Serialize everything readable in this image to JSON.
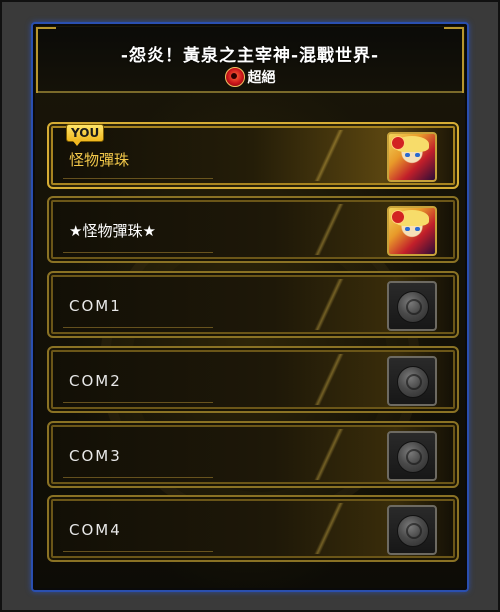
{
  "header": {
    "title": "-怨炎！黃泉之主宰神-混戰世界-",
    "difficulty": {
      "label": "超絕",
      "icon": "difficulty-emblem-icon"
    }
  },
  "players": [
    {
      "badge": "YOU",
      "name": "怪物彈珠",
      "avatar": "character-portrait-icon",
      "is_self": true
    },
    {
      "name": "★怪物彈珠★",
      "avatar": "character-portrait-icon",
      "is_self": false
    },
    {
      "name": "COM1",
      "avatar": "empty-orb-icon",
      "is_self": false
    },
    {
      "name": "COM2",
      "avatar": "empty-orb-icon",
      "is_self": false
    },
    {
      "name": "COM3",
      "avatar": "empty-orb-icon",
      "is_self": false
    },
    {
      "name": "COM4",
      "avatar": "empty-orb-icon",
      "is_self": false
    }
  ],
  "colors": {
    "panel_border": "#2a4fb0",
    "gold": "#d6ad35",
    "you_text": "#f2c84a"
  }
}
